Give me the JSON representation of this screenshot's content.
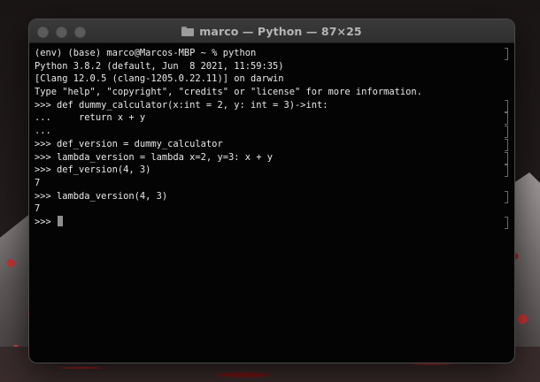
{
  "window": {
    "title": "marco — Python — 87×25"
  },
  "terminal": {
    "lines": [
      "(env) (base) marco@Marcos-MBP ~ % python",
      "Python 3.8.2 (default, Jun  8 2021, 11:59:35)",
      "[Clang 12.0.5 (clang-1205.0.22.11)] on darwin",
      "Type \"help\", \"copyright\", \"credits\" or \"license\" for more information.",
      ">>> def dummy_calculator(x:int = 2, y: int = 3)->int:",
      "...     return x + y",
      "...",
      ">>> def_version = dummy_calculator",
      ">>> lambda_version = lambda x=2, y=3: x + y",
      ">>> def_version(4, 3)",
      "7",
      ">>> lambda_version(4, 3)",
      "7"
    ],
    "prompt": ">>> "
  },
  "colors": {
    "terminal_bg": "#151515",
    "text": "#e8e8e8",
    "titlebar": "#353535"
  },
  "icons": {
    "title_icon": "folder-icon",
    "traffic_lights": [
      "close-button",
      "minimize-button",
      "zoom-button"
    ]
  }
}
